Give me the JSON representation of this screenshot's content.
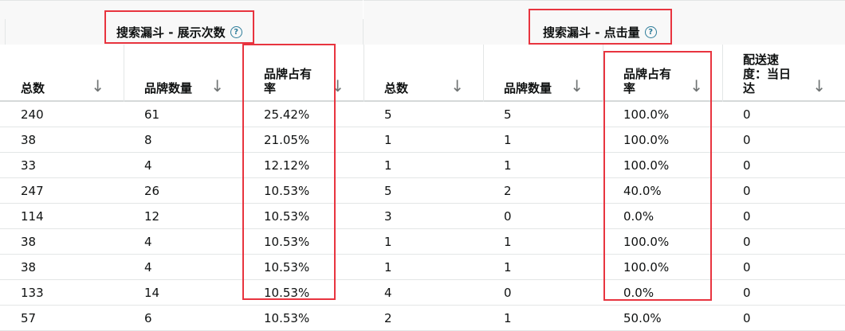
{
  "groups": [
    {
      "label": "搜索漏斗 - 展示次数",
      "help": "?"
    },
    {
      "label": "搜索漏斗 - 点击量",
      "help": "?"
    }
  ],
  "columns": [
    "总数",
    "品牌数量",
    "品牌占有\n率",
    "总数",
    "品牌数量",
    "品牌占有\n率",
    "配送速\n度：当日\n达"
  ],
  "sort_arrow": "↓",
  "rows": [
    [
      "240",
      "61",
      "25.42%",
      "5",
      "5",
      "100.0%",
      "0"
    ],
    [
      "38",
      "8",
      "21.05%",
      "1",
      "1",
      "100.0%",
      "0"
    ],
    [
      "33",
      "4",
      "12.12%",
      "1",
      "1",
      "100.0%",
      "0"
    ],
    [
      "247",
      "26",
      "10.53%",
      "5",
      "2",
      "40.0%",
      "0"
    ],
    [
      "114",
      "12",
      "10.53%",
      "3",
      "0",
      "0.0%",
      "0"
    ],
    [
      "38",
      "4",
      "10.53%",
      "1",
      "1",
      "100.0%",
      "0"
    ],
    [
      "38",
      "4",
      "10.53%",
      "1",
      "1",
      "100.0%",
      "0"
    ],
    [
      "133",
      "14",
      "10.53%",
      "4",
      "0",
      "0.0%",
      "0"
    ],
    [
      "57",
      "6",
      "10.53%",
      "2",
      "1",
      "50.0%",
      "0"
    ]
  ],
  "colors": {
    "highlight": "#e8343f",
    "header_bg": "#f8f8f8",
    "border": "#e3e6e6",
    "help_icon": "#2e7d9a"
  }
}
